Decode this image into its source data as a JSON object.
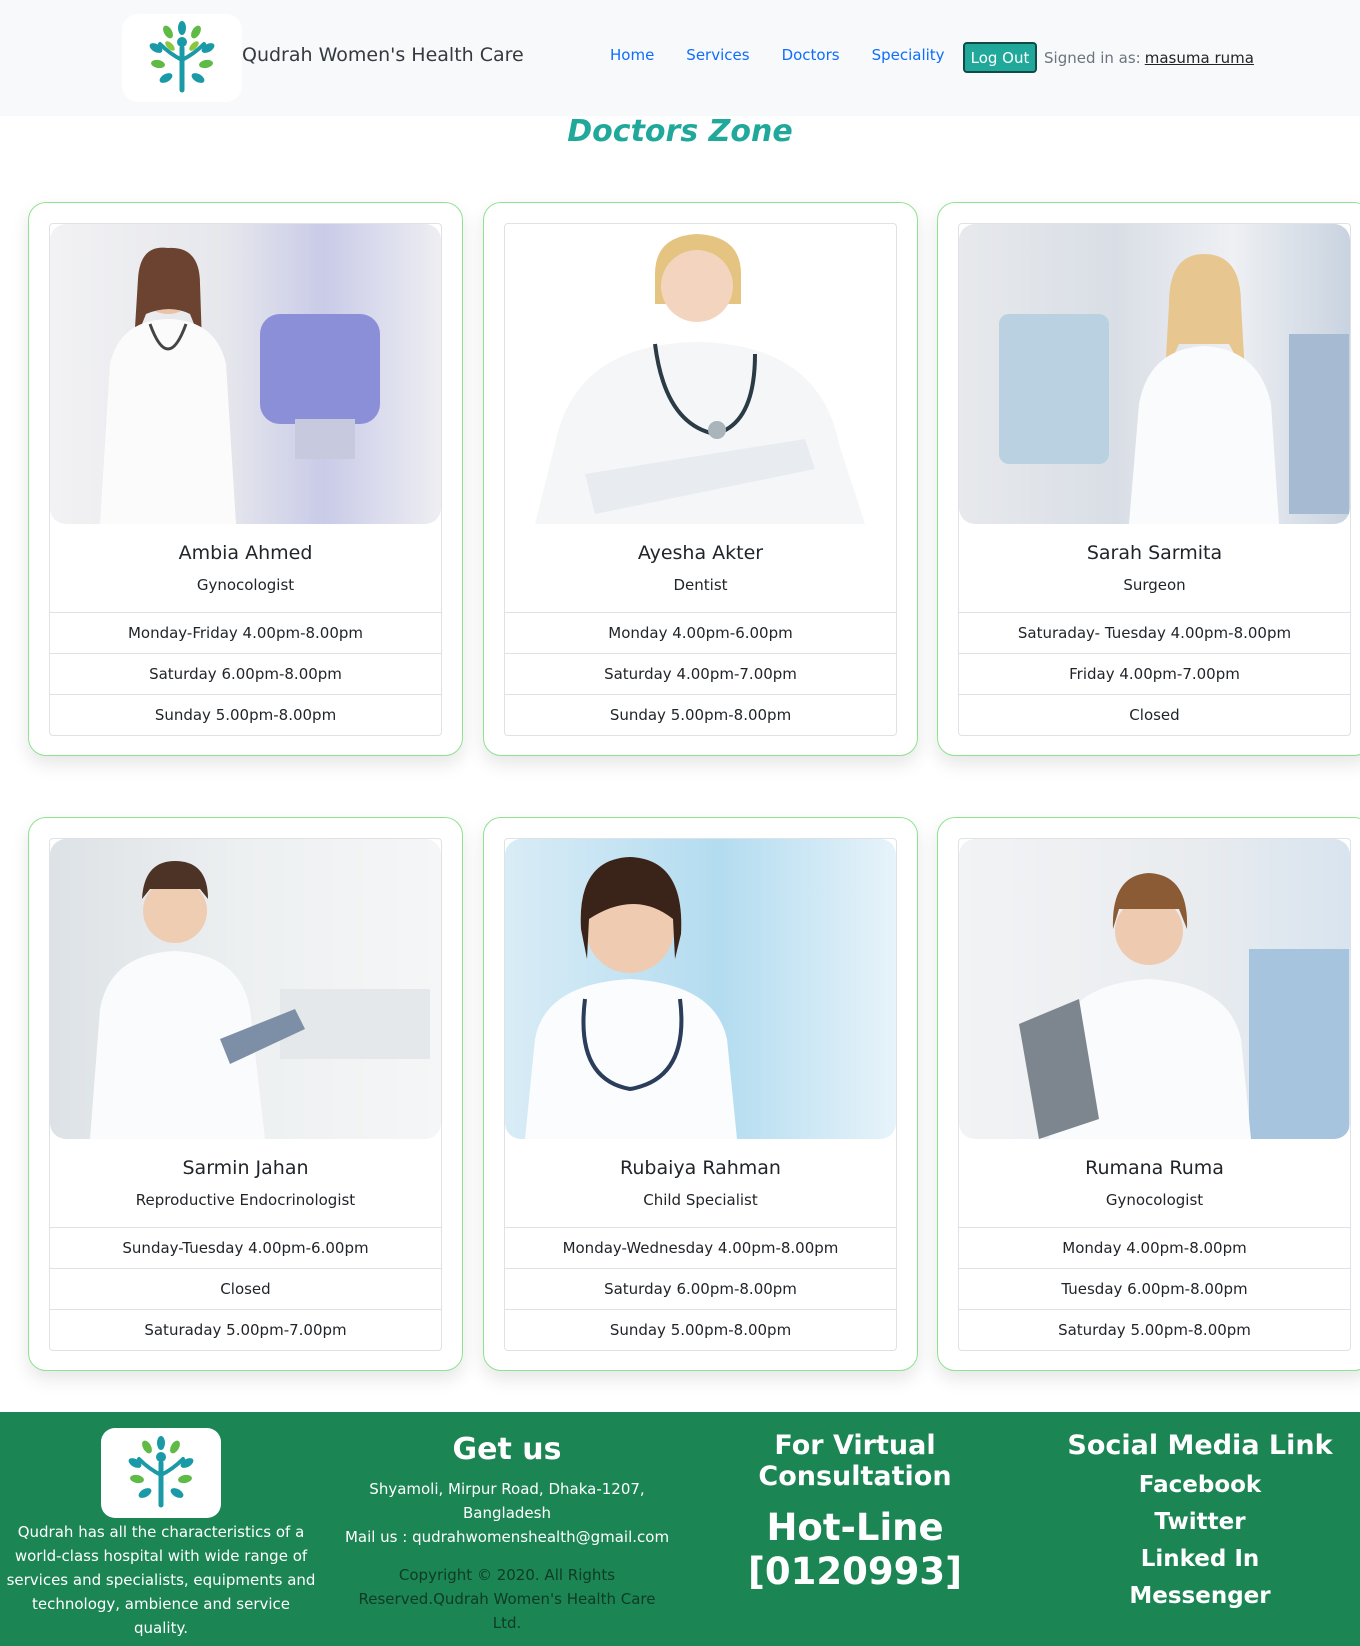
{
  "navbar": {
    "brand": "Qudrah Women's Health Care",
    "links": [
      "Home",
      "Services",
      "Doctors",
      "Speciality"
    ],
    "logout_label": "Log Out",
    "signed_in_prefix": "Signed in as:",
    "user_name": "masuma ruma"
  },
  "page_title": "Doctors Zone",
  "doctors": [
    {
      "name": "Ambia Ahmed",
      "specialty": "Gynocologist",
      "schedule": [
        "Monday-Friday 4.00pm-8.00pm",
        "Saturday 6.00pm-8.00pm",
        "Sunday 5.00pm-8.00pm"
      ]
    },
    {
      "name": "Ayesha Akter",
      "specialty": "Dentist",
      "schedule": [
        "Monday 4.00pm-6.00pm",
        "Saturday 4.00pm-7.00pm",
        "Sunday 5.00pm-8.00pm"
      ]
    },
    {
      "name": "Sarah Sarmita",
      "specialty": "Surgeon",
      "schedule": [
        "Saturaday- Tuesday 4.00pm-8.00pm",
        "Friday 4.00pm-7.00pm",
        "Closed"
      ]
    },
    {
      "name": "Sarmin Jahan",
      "specialty": "Reproductive Endocrinologist",
      "schedule": [
        "Sunday-Tuesday 4.00pm-6.00pm",
        "Closed",
        "Saturaday 5.00pm-7.00pm"
      ]
    },
    {
      "name": "Rubaiya Rahman",
      "specialty": "Child Specialist",
      "schedule": [
        "Monday-Wednesday 4.00pm-8.00pm",
        "Saturday 6.00pm-8.00pm",
        "Sunday 5.00pm-8.00pm"
      ]
    },
    {
      "name": "Rumana Ruma",
      "specialty": "Gynocologist",
      "schedule": [
        "Monday 4.00pm-8.00pm",
        "Tuesday 6.00pm-8.00pm",
        "Saturday 5.00pm-8.00pm"
      ]
    }
  ],
  "footer": {
    "about": "Qudrah has all the characteristics of a world-class hospital with wide range of services and specialists, equipments and technology, ambience and service quality.",
    "get_us_title": "Get us",
    "address": "Shyamoli, Mirpur Road, Dhaka-1207, Bangladesh",
    "mail": "Mail us : qudrahwomenshealth@gmail.com",
    "copyright": "Copyright © 2020. All Rights Reserved.Qudrah Women's Health Care Ltd.",
    "virtual_title": "For Virtual Consultation",
    "hotline_label": "Hot-Line",
    "hotline_number": "[0120993]",
    "social_title": "Social Media Link",
    "social_links": [
      "Facebook",
      "Twitter",
      "Linked In",
      "Messenger"
    ]
  },
  "colors": {
    "accent": "#20a99a",
    "footer": "#1b8554",
    "card_border": "#8fe28f",
    "link": "#0d6efd"
  }
}
